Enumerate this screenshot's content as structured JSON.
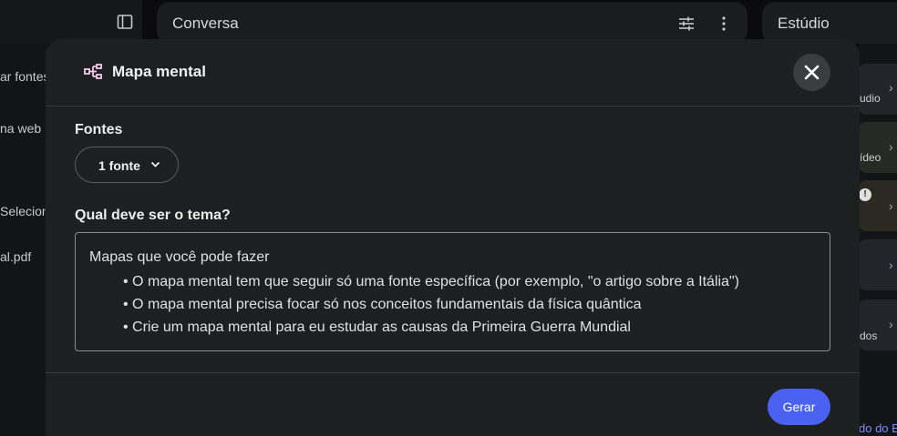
{
  "background": {
    "left_panel": {
      "items": [
        {
          "label": "ar fontes"
        },
        {
          "label": "na web"
        },
        {
          "label": "Selecion"
        },
        {
          "label": "al.pdf"
        }
      ]
    },
    "conversation": {
      "title": "Conversa"
    },
    "studio": {
      "title": "Estúdio",
      "cards": [
        {
          "label": "udio"
        },
        {
          "label": "ídeo"
        },
        {
          "label": ""
        },
        {
          "label": ""
        },
        {
          "label": "dos"
        }
      ],
      "badge": "!",
      "link": "do do E"
    }
  },
  "modal": {
    "title": "Mapa mental",
    "icon": "mind-map-icon",
    "sources_label": "Fontes",
    "sources_button": "1 fonte",
    "theme_label": "Qual deve ser o tema?",
    "theme_placeholder": "Mapas que você pode fazer",
    "theme_examples": [
      "O mapa mental tem que seguir só uma fonte específica (por exemplo, \"o artigo sobre a Itália\")",
      "O mapa mental precisa focar só nos conceitos fundamentais da física quântica",
      "Crie um mapa mental para eu estudar as causas da Primeira Guerra Mundial"
    ],
    "generate_button": "Gerar",
    "accent_color": "#4a61f2"
  }
}
